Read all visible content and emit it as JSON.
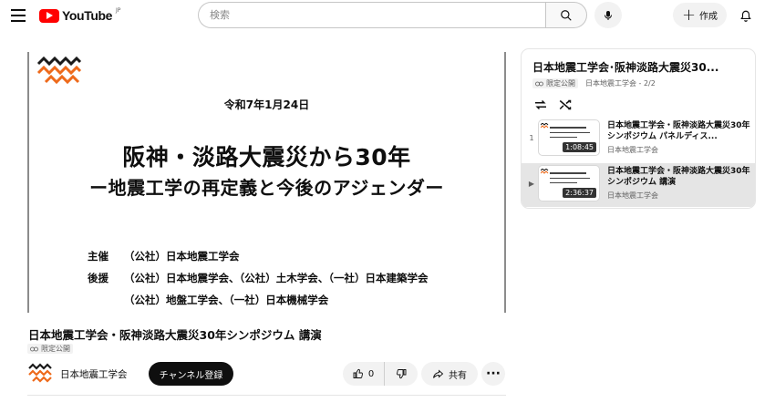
{
  "header": {
    "logo_text": "YouTube",
    "logo_region": "JP",
    "search_placeholder": "検索",
    "create_label": "作成"
  },
  "slide": {
    "date": "令和7年1月24日",
    "title_line1": "阪神・淡路大震災から30年",
    "title_line2": "ー地震工学の再定義と今後のアジェンダー",
    "org_label_1": "主催",
    "org_value_1": "（公社）日本地震工学会",
    "org_label_2": "後援",
    "org_value_2": "（公社）日本地震学会、（公社）土木学会、（一社）日本建築学会",
    "org_value_3": "（公社）地盤工学会、（一社）日本機械学会"
  },
  "video": {
    "title": "日本地震工学会・阪神淡路大震災30年シンポジウム 講演",
    "visibility": "限定公開",
    "channel_name": "日本地震工学会",
    "subscribe_label": "チャンネル登録",
    "like_count": "0",
    "share_label": "共有"
  },
  "playlist": {
    "title": "日本地震工学会･阪神淡路大震災30...",
    "visibility": "限定公開",
    "channel_progress": "日本地震工学会 - 2/2",
    "items": [
      {
        "index": "1",
        "title": "日本地震工学会・阪神淡路大震災30年シンポジウム パネルディス...",
        "duration": "1:08:45",
        "channel": "日本地震工学会"
      },
      {
        "index": "▶",
        "title": "日本地震工学会・阪神淡路大震災30年シンポジウム 講演",
        "duration": "2:36:37",
        "channel": "日本地震工学会"
      }
    ]
  },
  "colors": {
    "brand_red": "#ff0000",
    "logo_black": "#1a1a1a",
    "logo_orange": "#ee6a1b"
  }
}
